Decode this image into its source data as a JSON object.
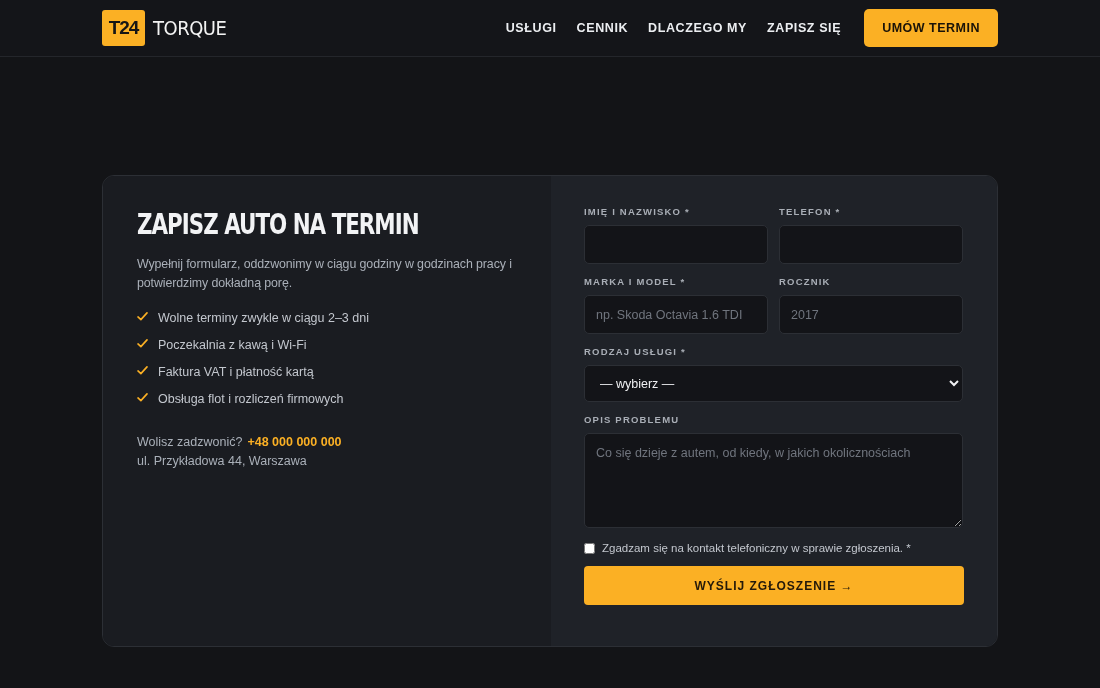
{
  "header": {
    "logo_mark": "T24",
    "logo_text": "TORQUE",
    "nav": [
      "USŁUGI",
      "CENNIK",
      "DLACZEGO MY",
      "ZAPISZ SIĘ"
    ],
    "cta": "UMÓW TERMIN"
  },
  "info": {
    "title": "ZAPISZ AUTO NA TERMIN",
    "intro": "Wypełnij formularz, oddzwonimy w ciągu godziny w godzinach pracy i potwierdzimy dokładną porę.",
    "features": [
      "Wolne terminy zwykle w ciągu 2–3 dni",
      "Poczekalnia z kawą i Wi-Fi",
      "Faktura VAT i płatność kartą",
      "Obsługa flot i rozliczeń firmowych"
    ],
    "call_prompt": "Wolisz zadzwonić?",
    "phone": "+48 000 000 000",
    "address": "ul. Przykładowa 44, Warszawa"
  },
  "form": {
    "fields": [
      {
        "kind": "input",
        "label": "IMIĘ I NAZWISKO *"
      },
      {
        "kind": "input",
        "label": "TELEFON *"
      },
      {
        "kind": "input",
        "label": "MARKA I MODEL *",
        "placeholder": "np. Skoda Octavia 1.6 TDI"
      },
      {
        "kind": "input",
        "label": "ROCZNIK",
        "placeholder": "2017"
      },
      {
        "kind": "select",
        "label": "RODZAJ USŁUGI *",
        "value": "— wybierz —"
      },
      {
        "kind": "textarea",
        "label": "OPIS PROBLEMU",
        "placeholder": "Co się dzieje z autem, od kiedy, w jakich okolicznościach"
      }
    ],
    "consent": {
      "label": "Zgadzam się na kontakt telefoniczny w sprawie zgłoszenia. *",
      "checked": false
    },
    "submit": "WYŚLIJ ZGŁOSZENIE →"
  }
}
